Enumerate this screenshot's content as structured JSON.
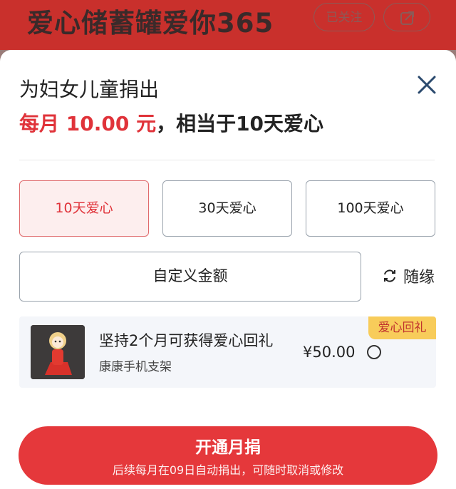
{
  "header": {
    "title": "爱心储蓄罐爱你365",
    "follow_label": "已关注",
    "icons": {
      "share": "share-icon"
    }
  },
  "sheet": {
    "title": "为妇女儿童捐出",
    "summary": {
      "prefix": "每月 10.00 元",
      "suffix": "，相当于10天爱心"
    },
    "options": [
      "10天爱心",
      "30天爱心",
      "100天爱心"
    ],
    "selected_option": "10天爱心",
    "custom_amount_label": "自定义金额",
    "random_label": "随缘",
    "gift": {
      "badge": "爱心回礼",
      "title": "坚持2个月可获得爱心回礼",
      "subtitle": "康康手机支架",
      "price": "¥50.00",
      "selected": false
    },
    "cta": {
      "label": "开通月捐",
      "note": "后续每月在09日自动捐出，可随时取消或修改"
    }
  },
  "colors": {
    "accent": "#e5383b",
    "selected_bg": "#fdeeee",
    "badge_bg": "#f8cc5a"
  }
}
